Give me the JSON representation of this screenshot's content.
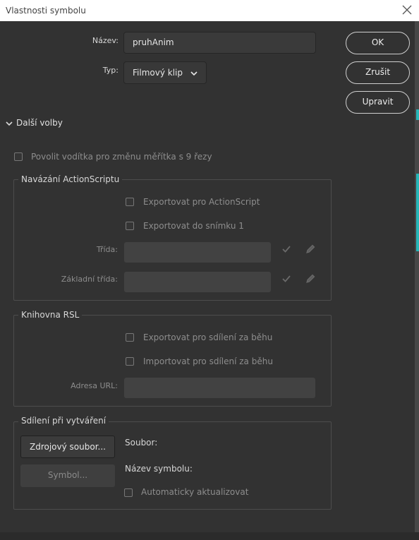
{
  "window": {
    "title": "Vlastnosti symbolu"
  },
  "fields": {
    "name_label": "Název:",
    "name_value": "pruhAnim",
    "type_label": "Typ:",
    "type_value": "Filmový klip"
  },
  "buttons": {
    "ok": "OK",
    "cancel": "Zrušit",
    "edit": "Upravit"
  },
  "advanced": {
    "label": "Další volby",
    "scale9": "Povolit vodítka pro změnu měřítka s 9 řezy"
  },
  "actionscript": {
    "legend": "Navázání ActionScriptu",
    "export_as": "Exportovat pro ActionScript",
    "export_frame1": "Exportovat do snímku 1",
    "class_label": "Třída:",
    "base_class_label": "Základní třída:"
  },
  "rsl": {
    "legend": "Knihovna RSL",
    "export_share": "Exportovat pro sdílení za běhu",
    "import_share": "Importovat pro sdílení za běhu",
    "url_label": "Adresa URL:"
  },
  "authoring": {
    "legend": "Sdílení při vytváření",
    "source_button": "Zdrojový soubor...",
    "symbol_button": "Symbol...",
    "file_label": "Soubor:",
    "symbol_name_label": "Název symbolu:",
    "auto_update": "Automaticky aktualizovat"
  },
  "colors": {
    "background": "#323232",
    "accent_edge": "#26b6b8",
    "title_bar": "#ffffff"
  },
  "icons": [
    "close-icon",
    "chevron-down-icon",
    "checkmark-icon",
    "pencil-icon"
  ]
}
